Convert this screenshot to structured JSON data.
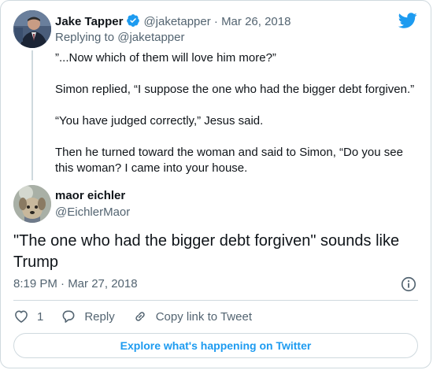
{
  "parent_tweet": {
    "author_name": "Jake Tapper",
    "author_handle": "@jaketapper",
    "separator": "·",
    "date": "Mar 26, 2018",
    "replying_to": "Replying to @jaketapper",
    "paragraphs": [
      "”...Now which of them will love him more?”",
      "Simon replied, “I suppose the one who had the bigger debt forgiven.”",
      "“You have judged correctly,” Jesus said.",
      "Then he turned toward the woman and said to Simon, “Do you see this woman? I came into your house."
    ]
  },
  "reply_tweet": {
    "author_name": "maor eichler",
    "author_handle": "@EichlerMaor",
    "text": "\"The one who had the bigger debt forgiven\" sounds like Trump",
    "timestamp": "8:19 PM · Mar 27, 2018",
    "like_count": "1",
    "reply_label": "Reply",
    "copy_link_label": "Copy link to Tweet"
  },
  "explore_button_label": "Explore what's happening on Twitter",
  "icons": {
    "logo": "twitter-bird-icon",
    "verified": "verified-badge-icon",
    "info": "info-icon",
    "like": "heart-icon",
    "reply": "speech-bubble-icon",
    "link": "link-icon"
  },
  "colors": {
    "accent": "#1d9bf0",
    "text": "#0f1419",
    "muted": "#536471",
    "border": "#cfd9de"
  }
}
